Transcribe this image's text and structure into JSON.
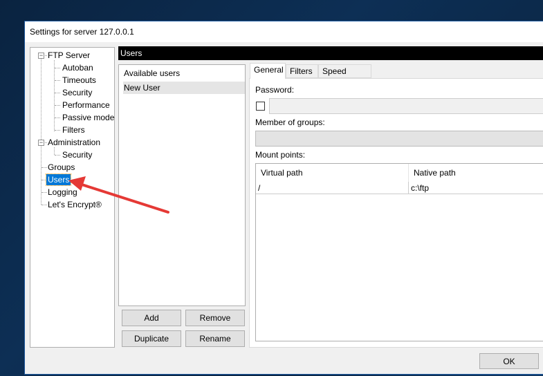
{
  "window": {
    "title": "Settings for server 127.0.0.1"
  },
  "tree": {
    "items": [
      {
        "label": "FTP Server",
        "level": 0,
        "expanded": true
      },
      {
        "label": "Autoban",
        "level": 1
      },
      {
        "label": "Timeouts",
        "level": 1
      },
      {
        "label": "Security",
        "level": 1
      },
      {
        "label": "Performance",
        "level": 1
      },
      {
        "label": "Passive mode",
        "level": 1
      },
      {
        "label": "Filters",
        "level": 1
      },
      {
        "label": "Administration",
        "level": 0,
        "expanded": true
      },
      {
        "label": "Security",
        "level": 1
      },
      {
        "label": "Groups",
        "level": 0
      },
      {
        "label": "Users",
        "level": 0,
        "selected": true
      },
      {
        "label": "Logging",
        "level": 0
      },
      {
        "label": "Let's Encrypt®",
        "level": 0
      }
    ]
  },
  "header": {
    "title": "Users"
  },
  "users": {
    "heading": "Available users",
    "items": [
      "New User"
    ],
    "buttons": {
      "add": "Add",
      "remove": "Remove",
      "duplicate": "Duplicate",
      "rename": "Rename"
    }
  },
  "tabs": [
    "General",
    "Filters",
    "Speed Limits"
  ],
  "general": {
    "password_label": "Password:",
    "password_value": "",
    "groups_label": "Member of groups:",
    "mount_label": "Mount points:",
    "columns": [
      "Virtual path",
      "Native path"
    ],
    "rows": [
      [
        "/",
        "c:\\ftp"
      ]
    ]
  },
  "footer": {
    "ok": "OK"
  },
  "colors": {
    "selection": "#0078d7",
    "arrow": "#e53935"
  }
}
